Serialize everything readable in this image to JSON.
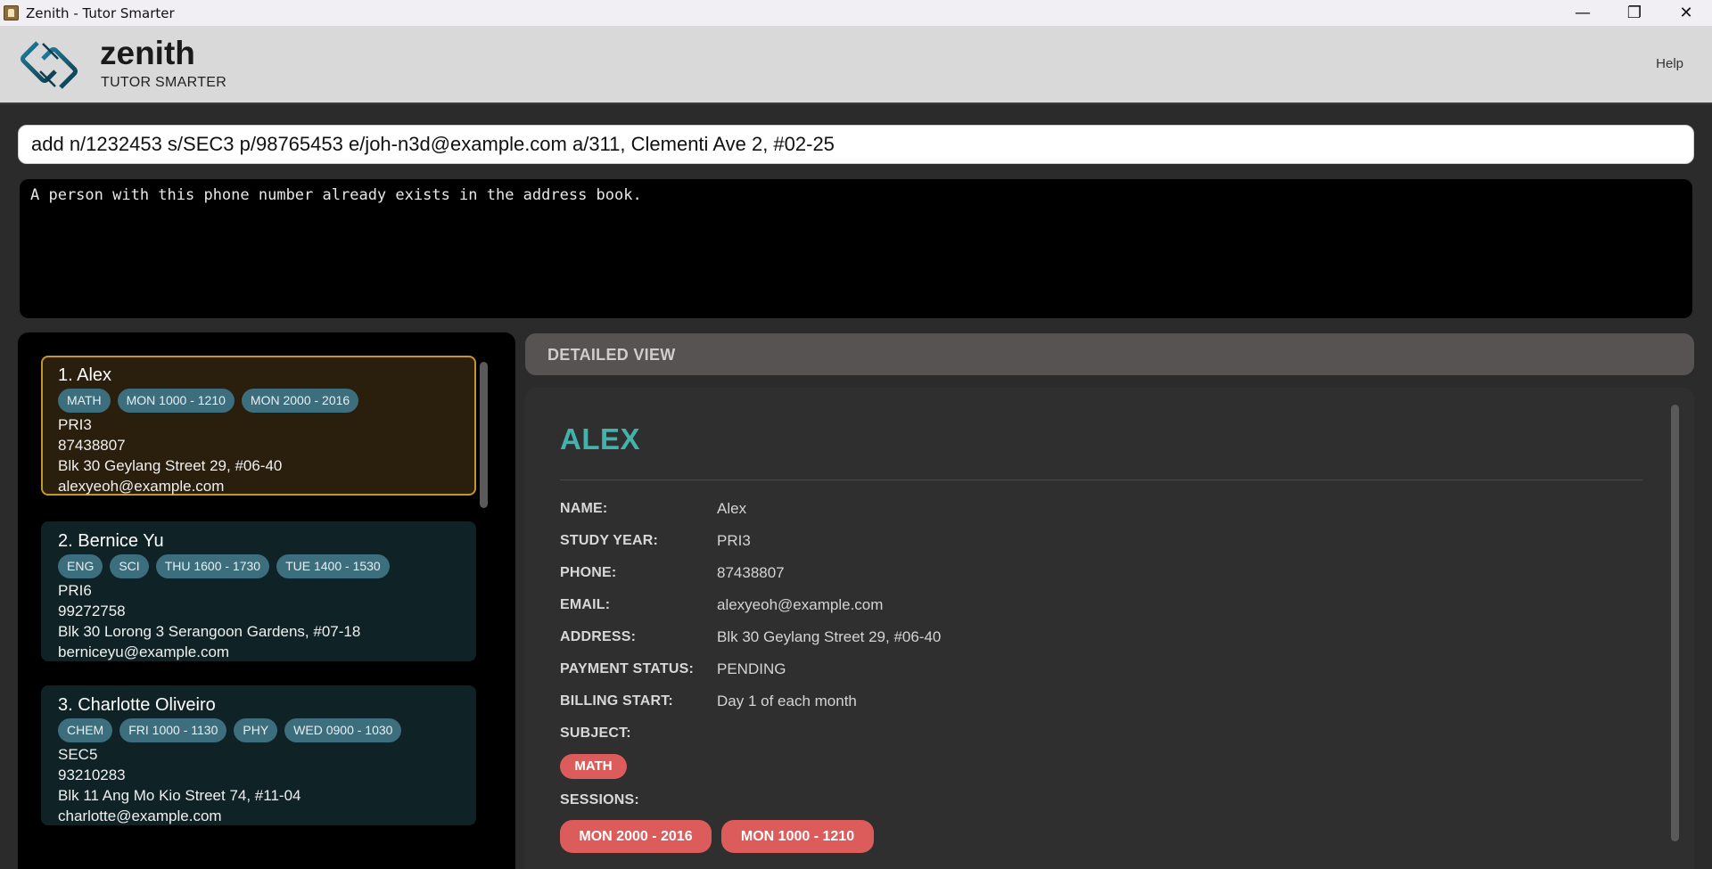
{
  "window": {
    "title": "Zenith - Tutor Smarter",
    "controls": {
      "minimize": "—",
      "maximize": "❐",
      "close": "✕"
    }
  },
  "header": {
    "brand": "zenith",
    "tagline": "TUTOR SMARTER",
    "help": "Help"
  },
  "command": {
    "value": "add n/1232453 s/SEC3 p/98765453 e/joh-n3d@example.com a/311, Clementi Ave 2, #02-25"
  },
  "result": {
    "message": "A person with this phone number already exists in the address book."
  },
  "persons": [
    {
      "title": "1. Alex",
      "tags": [
        "MATH",
        "MON 1000 - 1210",
        "MON 2000 - 2016"
      ],
      "study_year": "PRI3",
      "phone": "87438807",
      "address": "Blk 30 Geylang Street 29, #06-40",
      "email": "alexyeoh@example.com",
      "selected": true
    },
    {
      "title": "2. Bernice Yu",
      "tags": [
        "ENG",
        "SCI",
        "THU 1600 - 1730",
        "TUE 1400 - 1530"
      ],
      "study_year": "PRI6",
      "phone": "99272758",
      "address": "Blk 30 Lorong 3 Serangoon Gardens, #07-18",
      "email": "berniceyu@example.com",
      "selected": false
    },
    {
      "title": "3. Charlotte Oliveiro",
      "tags": [
        "CHEM",
        "FRI 1000 - 1130",
        "PHY",
        "WED 0900 - 1030"
      ],
      "study_year": "SEC5",
      "phone": "93210283",
      "address": "Blk 11 Ang Mo Kio Street 74, #11-04",
      "email": "charlotte@example.com",
      "selected": false
    }
  ],
  "detail": {
    "header": "DETAILED VIEW",
    "heading": "ALEX",
    "fields": [
      {
        "label": "NAME:",
        "value": "Alex"
      },
      {
        "label": "STUDY YEAR:",
        "value": "PRI3"
      },
      {
        "label": "PHONE:",
        "value": "87438807"
      },
      {
        "label": "EMAIL:",
        "value": "alexyeoh@example.com"
      },
      {
        "label": "ADDRESS:",
        "value": "Blk 30 Geylang Street 29, #06-40"
      },
      {
        "label": "PAYMENT STATUS:",
        "value": "PENDING"
      },
      {
        "label": "BILLING START:",
        "value": "Day 1 of each month"
      }
    ],
    "subject_label": "SUBJECT:",
    "subjects": [
      "MATH"
    ],
    "sessions_label": "SESSIONS:",
    "sessions": [
      "MON 2000 - 2016",
      "MON 1000 - 1210"
    ]
  },
  "colors": {
    "accent_teal": "#43b2ab",
    "tag_blue": "#3d6e7e",
    "pill_red": "#dc5c5c",
    "selected_border": "#c7952f"
  }
}
